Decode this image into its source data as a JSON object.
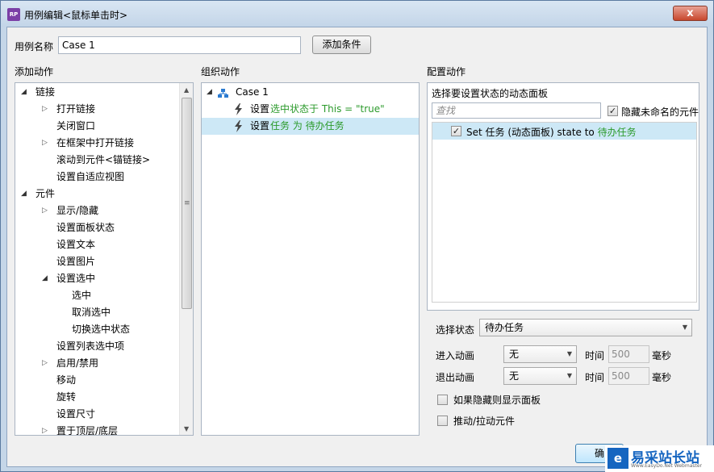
{
  "window": {
    "app_icon": "RP",
    "title": "用例编辑<鼠标单击时>",
    "close_glyph": "x"
  },
  "case_name": {
    "label": "用例名称",
    "value": "Case 1",
    "add_condition": "添加条件"
  },
  "sections": {
    "add_actions": "添加动作",
    "organize_actions": "组织动作",
    "configure_actions": "配置动作"
  },
  "add_actions_tree": [
    {
      "label": "链接",
      "level": 0,
      "expander": "open"
    },
    {
      "label": "打开链接",
      "level": 1,
      "expander": "closed"
    },
    {
      "label": "关闭窗口",
      "level": 1,
      "expander": "none"
    },
    {
      "label": "在框架中打开链接",
      "level": 1,
      "expander": "closed"
    },
    {
      "label": "滚动到元件<锚链接>",
      "level": 1,
      "expander": "none"
    },
    {
      "label": "设置自适应视图",
      "level": 1,
      "expander": "none"
    },
    {
      "label": "元件",
      "level": 0,
      "expander": "open"
    },
    {
      "label": "显示/隐藏",
      "level": 1,
      "expander": "closed"
    },
    {
      "label": "设置面板状态",
      "level": 1,
      "expander": "none"
    },
    {
      "label": "设置文本",
      "level": 1,
      "expander": "none"
    },
    {
      "label": "设置图片",
      "level": 1,
      "expander": "none"
    },
    {
      "label": "设置选中",
      "level": 1,
      "expander": "open"
    },
    {
      "label": "选中",
      "level": 2,
      "expander": "none"
    },
    {
      "label": "取消选中",
      "level": 2,
      "expander": "none"
    },
    {
      "label": "切换选中状态",
      "level": 2,
      "expander": "none"
    },
    {
      "label": "设置列表选中项",
      "level": 1,
      "expander": "none"
    },
    {
      "label": "启用/禁用",
      "level": 1,
      "expander": "closed"
    },
    {
      "label": "移动",
      "level": 1,
      "expander": "none"
    },
    {
      "label": "旋转",
      "level": 1,
      "expander": "none"
    },
    {
      "label": "设置尺寸",
      "level": 1,
      "expander": "none"
    },
    {
      "label": "置于顶层/底层",
      "level": 1,
      "expander": "closed"
    }
  ],
  "organize": {
    "case_label": "Case 1",
    "actions": [
      {
        "verb": "设置",
        "detail": "选中状态于 This = \"true\"",
        "selected": false
      },
      {
        "verb": "设置",
        "detail": "任务 为 待办任务",
        "selected": true
      }
    ]
  },
  "configure": {
    "panel_title": "选择要设置状态的动态面板",
    "search_placeholder": "查找",
    "hide_unnamed_label": "隐藏未命名的元件",
    "hide_unnamed_checked": true,
    "items": [
      {
        "text": "Set 任务 (动态面板) state to ",
        "highlight": "待办任务",
        "checked": true
      }
    ],
    "state_label": "选择状态",
    "state_value": "待办任务",
    "enter_anim_label": "进入动画",
    "enter_anim_value": "无",
    "exit_anim_label": "退出动画",
    "exit_anim_value": "无",
    "time_label": "时间",
    "enter_time": "500",
    "exit_time": "500",
    "ms_label": "毫秒",
    "show_if_hidden": "如果隐藏则显示面板",
    "push_pull": "推动/拉动元件",
    "show_if_hidden_checked": false,
    "push_pull_checked": false
  },
  "footer": {
    "ok_label": "确"
  },
  "watermark": {
    "logo": "e",
    "text": "易采站长站",
    "sub": "Www.EasyDo.Net Webmaster"
  }
}
